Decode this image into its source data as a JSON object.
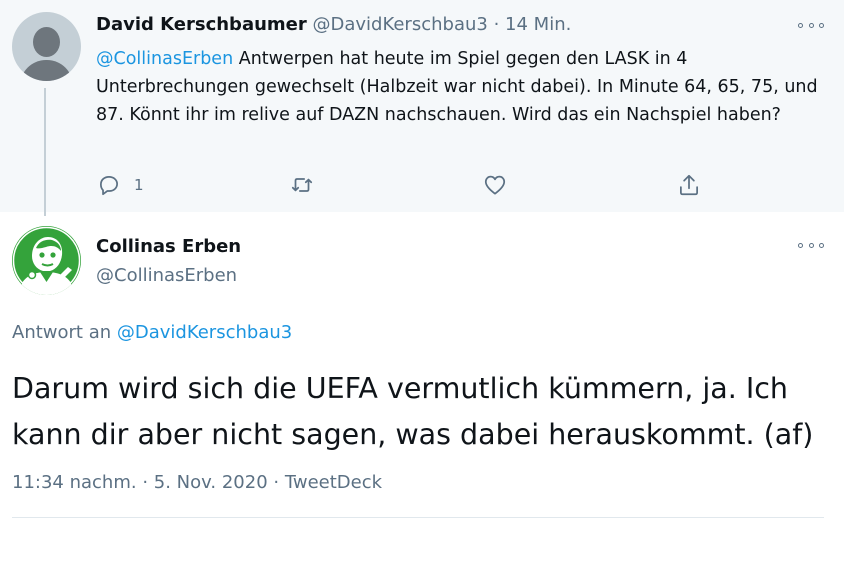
{
  "parent_tweet": {
    "author_name": "David Kerschbaumer",
    "handle": "@DavidKerschbau3",
    "separator": "·",
    "time": "14 Min.",
    "mention": "@CollinasErben",
    "text": " Antwerpen hat heute im Spiel gegen den LASK in 4 Unterbrechungen gewechselt (Halbzeit war nicht dabei). In Minute 64, 65, 75, und 87. Könnt ihr im relive auf DAZN nachschauen. Wird das ein Nachspiel haben?",
    "reply_count": "1",
    "icons": [
      "more-icon",
      "reply-icon",
      "retweet-icon",
      "like-icon",
      "share-icon"
    ]
  },
  "reply_tweet": {
    "author_name": "Collinas Erben",
    "handle": "@CollinasErben",
    "reply_to_label": "Antwort an ",
    "reply_to_handle": "@DavidKerschbau3",
    "text": "Darum wird sich die UEFA vermutlich kümmern, ja. Ich kann dir aber nicht sagen, was dabei herauskommt. (af)",
    "time": "11:34 nachm.",
    "separator": " · ",
    "date": "5. Nov. 2020",
    "source": "TweetDeck"
  },
  "colors": {
    "link": "#1b95e0",
    "secondary_text": "#5b7083",
    "parent_background": "#f5f8fa",
    "avatar_green": "#34a33b"
  }
}
